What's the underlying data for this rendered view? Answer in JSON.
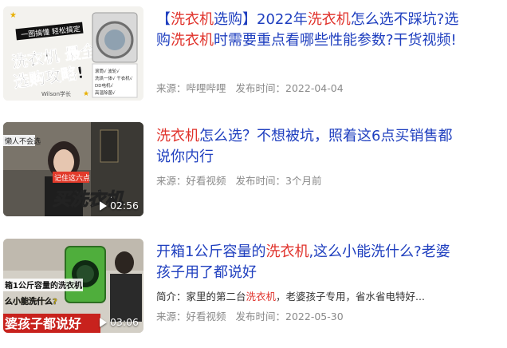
{
  "colors": {
    "title": "#1f3fbf",
    "highlight": "#e0322b",
    "meta": "#8a8a8a"
  },
  "results": [
    {
      "title_parts": [
        "【",
        "洗衣机",
        "选购】2022年",
        "洗衣机",
        "怎么选不踩坑?选购",
        "洗衣机",
        "时需要重点看哪些性能参数?干货视频!"
      ],
      "source": "来源：哔哩哔哩",
      "published": "发布时间：2022-04-04",
      "thumb": {
        "banner": "一图搞懂 轻松搞定",
        "headline": "洗衣机 最全",
        "sub": "选购攻略!",
        "author": "Wilson学长",
        "checks": [
          "滚筒√ 波轮√",
          "洗烘一体√ 干衣机√",
          "DD电机√",
          "高温除菌√"
        ]
      }
    },
    {
      "title_parts": [
        "洗衣机",
        "怎么选？不想被坑，照着这6点买销售都说你内行"
      ],
      "source": "来源：好看视频",
      "published": "发布时间：3个月前",
      "thumb": {
        "caption_left": "懒人不会选",
        "tag": "记住这六点",
        "overlay": "买洗衣机",
        "duration": "02:56"
      }
    },
    {
      "title_parts": [
        "开箱1公斤容量的",
        "洗衣机",
        ",这么小能洗什么?老婆孩子用了都说好"
      ],
      "desc_parts": [
        "简介：家里的第二台",
        "洗衣机",
        "，老婆孩子专用，省水省电特好..."
      ],
      "source": "来源：好看视频",
      "published": "发布时间：2022-05-30",
      "thumb": {
        "top": "箱1公斤容量的洗衣机",
        "mid": "么小能洗什么?",
        "bottom": "婆孩子都说好",
        "duration": "03:06"
      }
    }
  ]
}
